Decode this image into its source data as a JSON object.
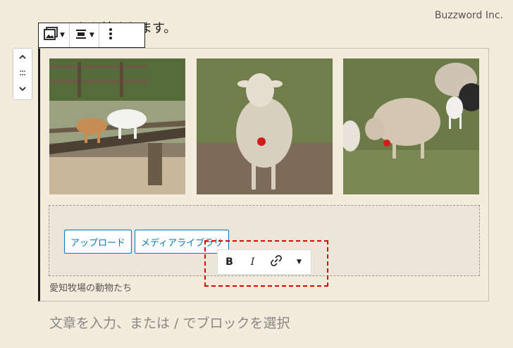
{
  "watermark": "Buzzword Inc.",
  "top_text": "ここから始まります。",
  "toolbar": {
    "icons": [
      "gallery-icon",
      "align-icon",
      "more-options-icon"
    ]
  },
  "mover": {
    "icons": [
      "chevron-up-icon",
      "drag-handle-icon",
      "chevron-down-icon"
    ]
  },
  "gallery": {
    "images": [
      {
        "name": "goats-on-fence"
      },
      {
        "name": "sheep-front"
      },
      {
        "name": "sheep-grazing"
      }
    ]
  },
  "buttons": {
    "upload": "アップロード",
    "media_library": "メディアライブラリ"
  },
  "caption": "愛知牧場の動物たち",
  "format_toolbar": {
    "bold": "B",
    "italic": "I",
    "link_icon": "link-icon",
    "more_icon": "caret-down-icon"
  },
  "appender_placeholder": "文章を入力、または / でブロックを選択"
}
